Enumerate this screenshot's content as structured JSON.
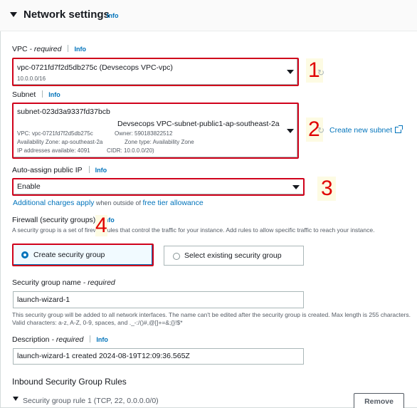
{
  "header": {
    "title": "Network settings",
    "info": "Info"
  },
  "vpc": {
    "label": "VPC",
    "req": " - required",
    "info": "Info",
    "value": "vpc-0721fd7f2d5db275c (Devsecops VPC-vpc)",
    "cidr": "10.0.0.0/16"
  },
  "subnet": {
    "label": "Subnet",
    "info": "Info",
    "value": "subnet-023d3a9337fd37bcb",
    "name": "Devsecops VPC-subnet-public1-ap-southeast-2a",
    "line1a": "VPC: vpc-0721fd7f2d5db275c",
    "line1b": "Owner: 590183822512",
    "line2a": "Availability Zone: ap-southeast-2a",
    "line2b": "Zone type: Availability Zone",
    "line3a": "IP addresses available: 4091",
    "line3b": "CIDR: 10.0.0.0/20)",
    "create_link": "Create new subnet"
  },
  "auto_ip": {
    "label": "Auto-assign public IP",
    "info": "Info",
    "value": "Enable",
    "charges_link": "Additional charges apply",
    "charges_mid": " when outside of ",
    "free_link": "free tier allowance"
  },
  "firewall": {
    "label": "Firewall (security groups)",
    "info": "Info",
    "hint": "A security group is a set of firewall rules that control the traffic for your instance. Add rules to allow specific traffic to reach your instance.",
    "option_create": "Create security group",
    "option_existing": "Select existing security group"
  },
  "sg_name": {
    "label": "Security group name",
    "req": " - required",
    "value": "launch-wizard-1",
    "hint": "This security group will be added to all network interfaces. The name can't be edited after the security group is created. Max length is 255 characters. Valid characters: a-z, A-Z, 0-9, spaces, and ._-:/()#,@[]+=&;{}!$*"
  },
  "description": {
    "label": "Description",
    "req": " - required",
    "info": "Info",
    "value": "launch-wizard-1 created 2024-08-19T12:09:36.565Z"
  },
  "inbound": {
    "title": "Inbound Security Group Rules",
    "rule1": "Security group rule 1 (TCP, 22, 0.0.0.0/0)",
    "remove": "Remove"
  },
  "annotations": [
    "1",
    "2",
    "3",
    "4"
  ],
  "colors": {
    "accent": "#0073bb",
    "annotation": "#d0021b"
  }
}
